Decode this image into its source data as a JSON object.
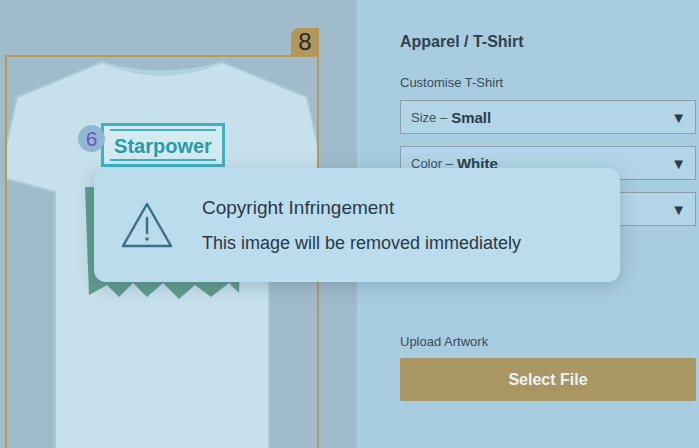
{
  "product": {
    "badge": "8",
    "print_text": "Starpower",
    "print_badge": "6"
  },
  "panel": {
    "breadcrumb": "Apparel / T-Shirt",
    "section_label": "Customise T-Shirt",
    "dropdowns": [
      {
        "label": "Size –",
        "value": "Small",
        "arrow": "▼"
      },
      {
        "label": "Color –",
        "value": "White",
        "arrow": "▼"
      },
      {
        "arrow": "▼"
      }
    ],
    "upload_label": "Upload Artwork",
    "button": "Select File"
  },
  "dialog": {
    "title": "Copyright Infringement",
    "message": "This image will be removed immediately"
  }
}
